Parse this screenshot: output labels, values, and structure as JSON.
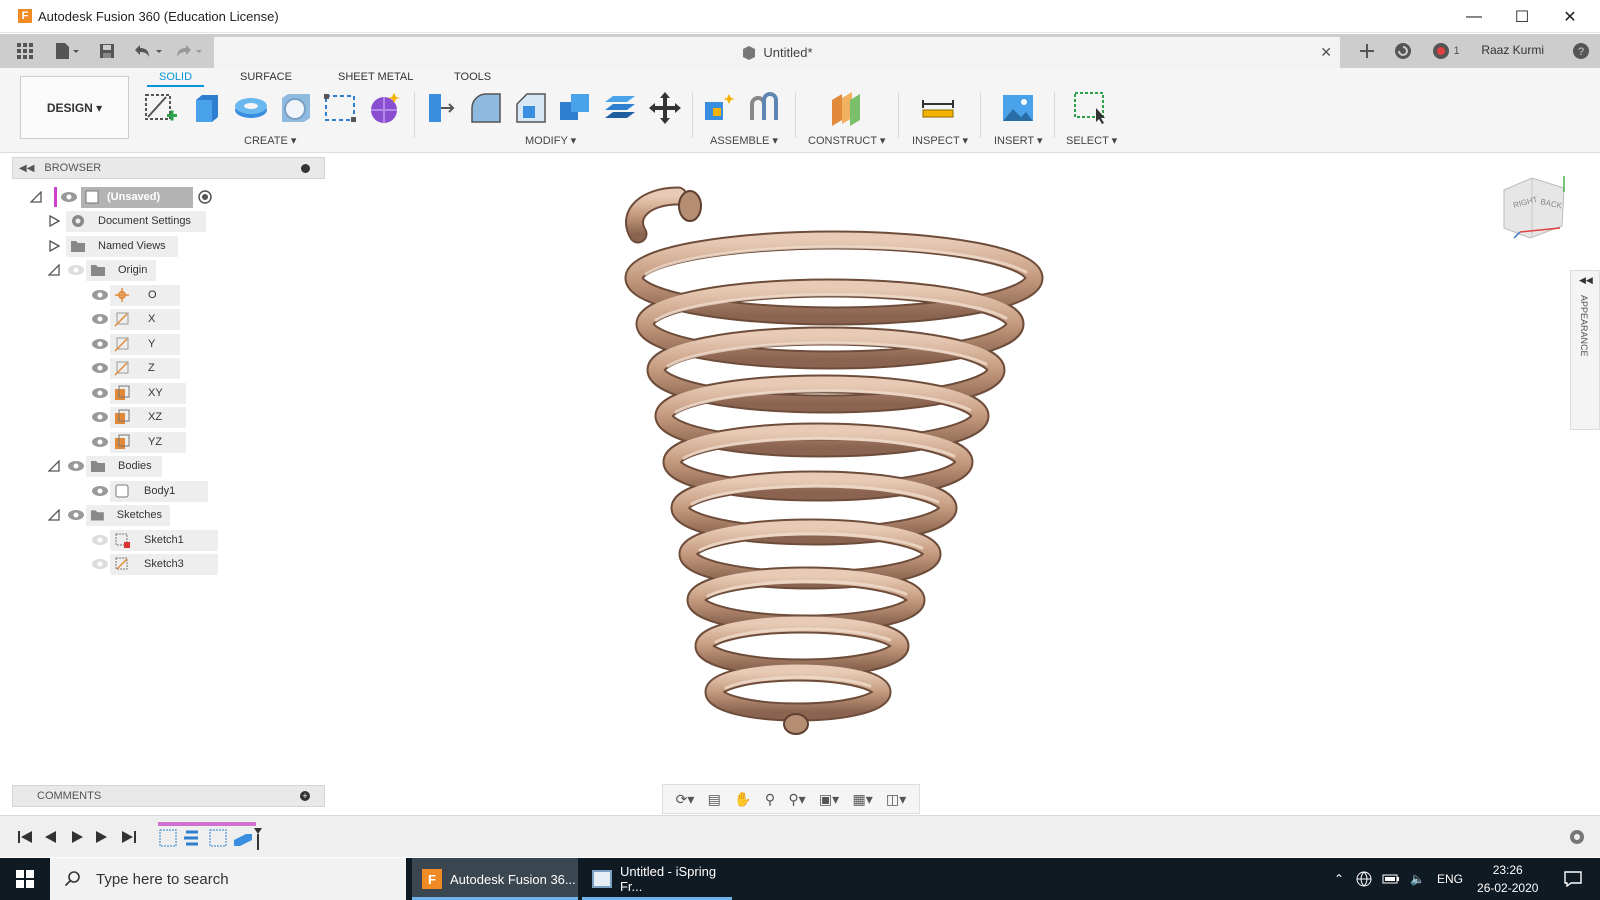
{
  "window": {
    "title": "Autodesk Fusion 360 (Education License)",
    "app_logo": "F",
    "controls": [
      "minimize-icon",
      "maximize-icon",
      "close-icon"
    ]
  },
  "topbar": {
    "document_title": "Untitled*",
    "notification_count": "1",
    "user_name": "Raaz Kurmi"
  },
  "toolbar": {
    "workspace_button": "DESIGN ▾",
    "tabs": [
      "SOLID",
      "SURFACE",
      "SHEET METAL",
      "TOOLS"
    ],
    "groups": [
      "CREATE ▾",
      "MODIFY ▾",
      "ASSEMBLE ▾",
      "CONSTRUCT ▾",
      "INSPECT ▾",
      "INSERT ▾",
      "SELECT ▾"
    ]
  },
  "browser": {
    "header": "BROWSER",
    "items": [
      {
        "label": "(Unsaved)"
      },
      {
        "label": "Document Settings"
      },
      {
        "label": "Named Views"
      },
      {
        "label": "Origin"
      },
      {
        "label": "O"
      },
      {
        "label": "X"
      },
      {
        "label": "Y"
      },
      {
        "label": "Z"
      },
      {
        "label": "XY"
      },
      {
        "label": "XZ"
      },
      {
        "label": "YZ"
      },
      {
        "label": "Bodies"
      },
      {
        "label": "Body1"
      },
      {
        "label": "Sketches"
      },
      {
        "label": "Sketch1"
      },
      {
        "label": "Sketch3"
      }
    ]
  },
  "comments": {
    "header": "COMMENTS"
  },
  "viewcube": {
    "right": "RIGHT",
    "back": "BACK"
  },
  "appearance_panel": {
    "label": "APPEARANCE"
  },
  "taskbar": {
    "search_placeholder": "Type here to search",
    "tasks": [
      "Autodesk Fusion 36...",
      "Untitled - iSpring Fr..."
    ],
    "language": "ENG",
    "time": "23:26",
    "date": "26-02-2020"
  },
  "colors": {
    "accent": "#0696d7",
    "spring": "#c9a48a",
    "taskbar": "#101a22"
  }
}
